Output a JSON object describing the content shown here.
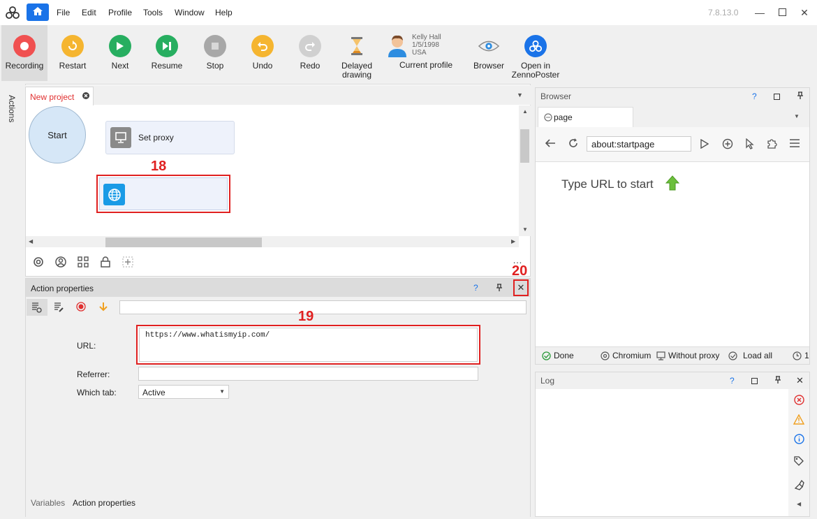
{
  "menu": [
    "File",
    "Edit",
    "Profile",
    "Tools",
    "Window",
    "Help"
  ],
  "version": "7.8.13.0",
  "toolbar": {
    "recording": "Recording",
    "restart": "Restart",
    "next": "Next",
    "resume": "Resume",
    "stop": "Stop",
    "undo": "Undo",
    "redo": "Redo",
    "delayed_line1": "Delayed",
    "delayed_line2": "drawing",
    "profile_name": "Kelly Hall",
    "profile_date": "1/5/1998",
    "profile_country": "USA",
    "current_profile": "Current profile",
    "browser": "Browser",
    "open_line1": "Open in",
    "open_line2": "ZennoPoster"
  },
  "actions_label": "Actions",
  "project": {
    "tab_label": "New project",
    "start_label": "Start",
    "setproxy_label": "Set proxy",
    "annotation_18": "18"
  },
  "props": {
    "title": "Action properties",
    "help": "?",
    "annotation_19": "19",
    "annotation_20": "20",
    "url_label": "URL:",
    "url_value": "https://www.whatismyip.com/",
    "referrer_label": "Referrer:",
    "which_tab_label": "Which tab:",
    "which_tab_value": "Active",
    "bottom_tab_variables": "Variables",
    "bottom_tab_props": "Action properties"
  },
  "browser": {
    "title": "Browser",
    "help": "?",
    "tab_label": "page",
    "address": "about:startpage",
    "prompt": "Type URL to start",
    "status_done": "Done",
    "status_engine": "Chromium",
    "status_proxy": "Without proxy",
    "status_load": "Load all",
    "status_timer": "1"
  },
  "log": {
    "title": "Log",
    "help": "?"
  }
}
